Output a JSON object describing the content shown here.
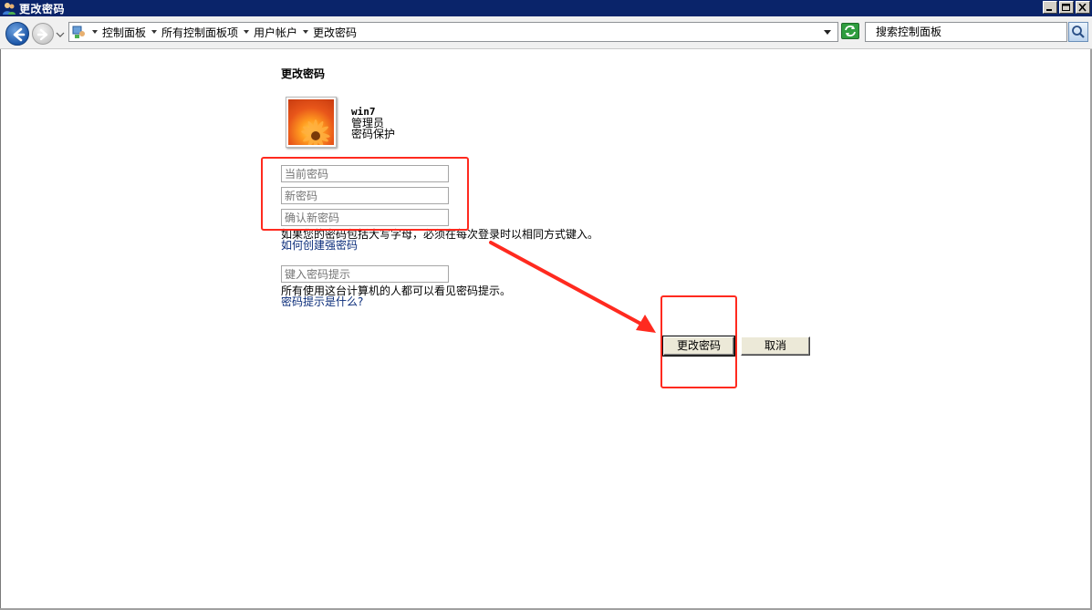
{
  "window": {
    "title": "更改密码"
  },
  "address_bar": {
    "breadcrumbs": [
      "控制面板",
      "所有控制面板项",
      "用户帐户",
      "更改密码"
    ],
    "search_placeholder": "搜索控制面板"
  },
  "page": {
    "title": "更改密码",
    "user": {
      "name": "win7",
      "role": "管理员",
      "status": "密码保护"
    },
    "fields": {
      "current_password_placeholder": "当前密码",
      "new_password_placeholder": "新密码",
      "confirm_password_placeholder": "确认新密码",
      "hint_placeholder": "键入密码提示"
    },
    "case_note": "如果您的密码包括大写字母，必须在每次登录时以相同方式键入。",
    "strong_password_link": "如何创建强密码",
    "hint_note": "所有使用这台计算机的人都可以看见密码提示。",
    "hint_link": "密码提示是什么?",
    "buttons": {
      "change_password": "更改密码",
      "cancel": "取消"
    }
  },
  "colors": {
    "annotation": "#ff2a1f",
    "titlebar": "#0a246a",
    "link": "#0a2c7a"
  }
}
